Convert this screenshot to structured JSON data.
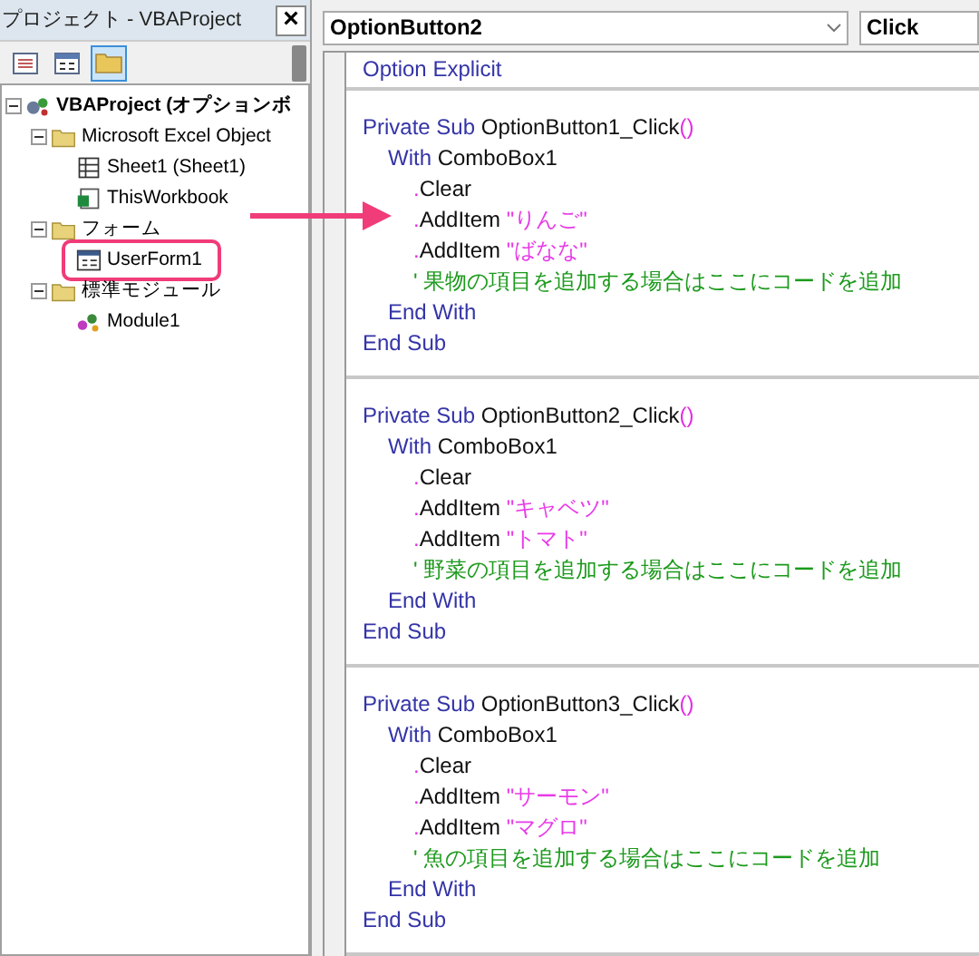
{
  "project_panel": {
    "title": "プロジェクト - VBAProject",
    "close": "×",
    "toolbar": [
      {
        "kind": "view-code",
        "selected": false
      },
      {
        "kind": "view-object",
        "selected": false
      },
      {
        "kind": "folder",
        "selected": true
      }
    ],
    "tree": [
      {
        "label": "VBAProject (オプションボ",
        "kind": "project",
        "expanded": true,
        "highlighted": false,
        "children": [
          {
            "label": "Microsoft Excel Object",
            "kind": "folder",
            "expanded": true,
            "highlighted": false,
            "children": [
              {
                "label": "Sheet1 (Sheet1)",
                "kind": "sheet",
                "highlighted": false
              },
              {
                "label": "ThisWorkbook",
                "kind": "workbook",
                "highlighted": false
              }
            ]
          },
          {
            "label": "フォーム",
            "kind": "folder",
            "expanded": true,
            "highlighted": false,
            "children": [
              {
                "label": "UserForm1",
                "kind": "form",
                "highlighted": true
              }
            ]
          },
          {
            "label": "標準モジュール",
            "kind": "folder",
            "expanded": true,
            "highlighted": false,
            "children": [
              {
                "label": "Module1",
                "kind": "module",
                "highlighted": false
              }
            ]
          }
        ]
      }
    ]
  },
  "code_window": {
    "object_dropdown": "OptionButton2",
    "procedure_dropdown": "Click",
    "sections": [
      {
        "lines": [
          {
            "tokens": [
              {
                "kind": "keyword",
                "text": "Option Explicit"
              }
            ]
          }
        ]
      },
      {
        "lines": [
          {
            "tokens": [
              {
                "kind": "keyword",
                "text": "Private Sub "
              },
              {
                "kind": "plain",
                "text": "OptionButton1_Click"
              },
              {
                "kind": "symbol",
                "text": "()"
              }
            ],
            "children": [
              {
                "tokens": [
                  {
                    "kind": "keyword",
                    "text": "With "
                  },
                  {
                    "kind": "plain",
                    "text": "ComboBox1"
                  }
                ],
                "children": [
                  {
                    "tokens": [
                      {
                        "kind": "symbol",
                        "text": "."
                      },
                      {
                        "kind": "plain",
                        "text": "Clear"
                      }
                    ]
                  },
                  {
                    "tokens": [
                      {
                        "kind": "symbol",
                        "text": "."
                      },
                      {
                        "kind": "plain",
                        "text": "AddItem "
                      },
                      {
                        "kind": "string",
                        "text": "\"りんご\""
                      }
                    ]
                  },
                  {
                    "tokens": [
                      {
                        "kind": "symbol",
                        "text": "."
                      },
                      {
                        "kind": "plain",
                        "text": "AddItem "
                      },
                      {
                        "kind": "string",
                        "text": "\"ばなな\""
                      }
                    ]
                  },
                  {
                    "tokens": [
                      {
                        "kind": "comment",
                        "text": "' 果物の項目を追加する場合はここにコードを追加"
                      }
                    ]
                  }
                ]
              },
              {
                "tokens": [
                  {
                    "kind": "keyword",
                    "text": "End With"
                  }
                ]
              }
            ]
          },
          {
            "tokens": [
              {
                "kind": "keyword",
                "text": "End Sub"
              }
            ]
          }
        ]
      },
      {
        "lines": [
          {
            "tokens": [
              {
                "kind": "keyword",
                "text": "Private Sub "
              },
              {
                "kind": "plain",
                "text": "OptionButton2_Click"
              },
              {
                "kind": "symbol",
                "text": "()"
              }
            ],
            "children": [
              {
                "tokens": [
                  {
                    "kind": "keyword",
                    "text": "With "
                  },
                  {
                    "kind": "plain",
                    "text": "ComboBox1"
                  }
                ],
                "children": [
                  {
                    "tokens": [
                      {
                        "kind": "symbol",
                        "text": "."
                      },
                      {
                        "kind": "plain",
                        "text": "Clear"
                      }
                    ]
                  },
                  {
                    "tokens": [
                      {
                        "kind": "symbol",
                        "text": "."
                      },
                      {
                        "kind": "plain",
                        "text": "AddItem "
                      },
                      {
                        "kind": "string",
                        "text": "\"キャベツ\""
                      }
                    ]
                  },
                  {
                    "tokens": [
                      {
                        "kind": "symbol",
                        "text": "."
                      },
                      {
                        "kind": "plain",
                        "text": "AddItem "
                      },
                      {
                        "kind": "string",
                        "text": "\"トマト\""
                      }
                    ]
                  },
                  {
                    "tokens": [
                      {
                        "kind": "comment",
                        "text": "' 野菜の項目を追加する場合はここにコードを追加"
                      }
                    ]
                  }
                ]
              },
              {
                "tokens": [
                  {
                    "kind": "keyword",
                    "text": "End With"
                  }
                ]
              }
            ]
          },
          {
            "tokens": [
              {
                "kind": "keyword",
                "text": "End Sub"
              }
            ]
          }
        ]
      },
      {
        "lines": [
          {
            "tokens": [
              {
                "kind": "keyword",
                "text": "Private Sub "
              },
              {
                "kind": "plain",
                "text": "OptionButton3_Click"
              },
              {
                "kind": "symbol",
                "text": "()"
              }
            ],
            "children": [
              {
                "tokens": [
                  {
                    "kind": "keyword",
                    "text": "With "
                  },
                  {
                    "kind": "plain",
                    "text": "ComboBox1"
                  }
                ],
                "children": [
                  {
                    "tokens": [
                      {
                        "kind": "symbol",
                        "text": "."
                      },
                      {
                        "kind": "plain",
                        "text": "Clear"
                      }
                    ]
                  },
                  {
                    "tokens": [
                      {
                        "kind": "symbol",
                        "text": "."
                      },
                      {
                        "kind": "plain",
                        "text": "AddItem "
                      },
                      {
                        "kind": "string",
                        "text": "\"サーモン\""
                      }
                    ]
                  },
                  {
                    "tokens": [
                      {
                        "kind": "symbol",
                        "text": "."
                      },
                      {
                        "kind": "plain",
                        "text": "AddItem "
                      },
                      {
                        "kind": "string",
                        "text": "\"マグロ\""
                      }
                    ]
                  },
                  {
                    "tokens": [
                      {
                        "kind": "comment",
                        "text": "' 魚の項目を追加する場合はここにコードを追加"
                      }
                    ]
                  }
                ]
              },
              {
                "tokens": [
                  {
                    "kind": "keyword",
                    "text": "End With"
                  }
                ]
              }
            ]
          },
          {
            "tokens": [
              {
                "kind": "keyword",
                "text": "End Sub"
              }
            ]
          }
        ]
      }
    ]
  }
}
